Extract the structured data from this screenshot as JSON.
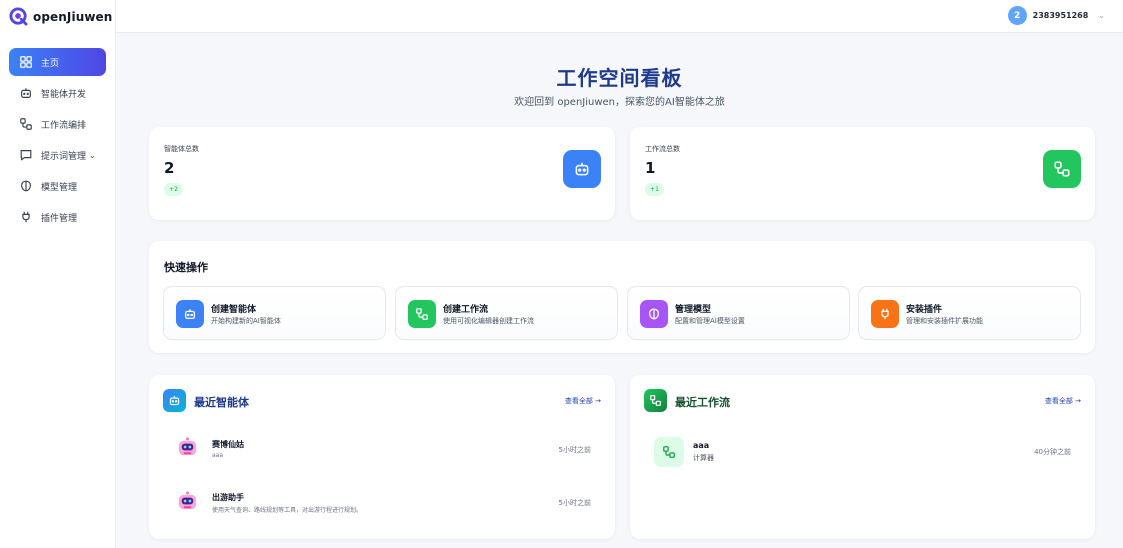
{
  "brand": {
    "name": "openJiuwen"
  },
  "sidebar": {
    "items": [
      {
        "label": "主页",
        "icon": "dashboard-icon",
        "active": true
      },
      {
        "label": "智能体开发",
        "icon": "robot-icon"
      },
      {
        "label": "工作流编排",
        "icon": "workflow-icon"
      },
      {
        "label": "提示词管理",
        "icon": "chat-icon",
        "caret": "⌄"
      },
      {
        "label": "模型管理",
        "icon": "brain-icon"
      },
      {
        "label": "插件管理",
        "icon": "plug-icon"
      }
    ]
  },
  "header": {
    "avatar_initial": "2",
    "username": "2383951268",
    "caret": "⌄"
  },
  "hero": {
    "title": "工作空间看板",
    "subtitle": "欢迎回到 openJiuwen，探索您的AI智能体之旅"
  },
  "stats": [
    {
      "label": "智能体总数",
      "value": "2",
      "delta": "+2",
      "icon": "robot-icon",
      "color": "#3b82f6"
    },
    {
      "label": "工作流总数",
      "value": "1",
      "delta": "+1",
      "icon": "workflow-icon",
      "color": "#22c55e"
    }
  ],
  "quick_actions": {
    "title": "快速操作",
    "items": [
      {
        "name": "创建智能体",
        "desc": "开始构建新的AI智能体",
        "icon": "robot-icon",
        "color": "#3b82f6"
      },
      {
        "name": "创建工作流",
        "desc": "使用可视化编辑器创建工作流",
        "icon": "workflow-icon",
        "color": "#22c55e"
      },
      {
        "name": "管理模型",
        "desc": "配置和管理AI模型设置",
        "icon": "brain-icon",
        "color": "#a855f7"
      },
      {
        "name": "安装插件",
        "desc": "管理和安装插件扩展功能",
        "icon": "plug-icon",
        "color": "#f97316"
      }
    ]
  },
  "recent_agents": {
    "title": "最近智能体",
    "view_all": "查看全部 →",
    "title_color": "#1e3a8a",
    "items": [
      {
        "name": "赛博仙姑",
        "desc": "aaa",
        "time": "5小时之前"
      },
      {
        "name": "出游助手",
        "desc": "使用天气查询、路线规划等工具，对出游行程进行规划。",
        "time": "5小时之前"
      }
    ]
  },
  "recent_workflows": {
    "title": "最近工作流",
    "view_all": "查看全部 →",
    "title_color": "#14532d",
    "items": [
      {
        "name": "aaa",
        "desc": "计算器",
        "time": "40分钟之前"
      }
    ]
  }
}
